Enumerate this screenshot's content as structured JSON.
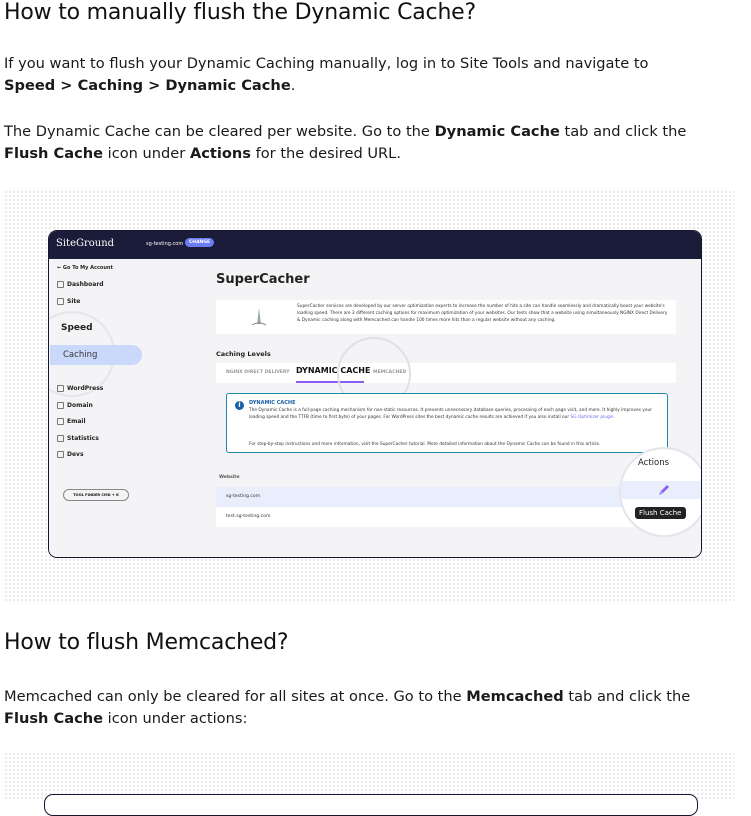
{
  "sections": [
    {
      "heading": "How to manually flush the Dynamic Cache?",
      "p1": {
        "text": "If you want to flush your Dynamic Caching manually, log in to Site Tools and navigate to ",
        "b1": "Speed > Caching > Dynamic Cache",
        "end": "."
      },
      "p2": {
        "t1": "The Dynamic Cache can be cleared per website. Go to the ",
        "b1": "Dynamic Cache",
        "t2": " tab and click the ",
        "b2": "Flush Cache",
        "t3": " icon under ",
        "b3": "Actions",
        "t4": " for the desired URL."
      }
    },
    {
      "heading": "How to flush Memcached?",
      "p1": {
        "t1": "Memcached can only be cleared for all sites at once. Go to the ",
        "b1": "Memcached",
        "t2": " tab and click the ",
        "b2": "Flush Cache",
        "t3": " icon under actions:"
      }
    }
  ],
  "screenshot": {
    "logo": "SiteGround",
    "domain": "sg-testing.com",
    "change": "CHANGE",
    "go_to_account": "← Go To My Account",
    "nav": [
      "Dashboard",
      "Site"
    ],
    "speed": "Speed",
    "caching": "Caching",
    "nav2": [
      "WordPress",
      "Domain",
      "Email",
      "Statistics",
      "Devs"
    ],
    "tool_finder": "TOOL FINDER CMD + K",
    "title": "SuperCacher",
    "intro": "SuperCacher services are developed by our server optimization experts to increase the number of hits a site can handle seamlessly and dramatically boost your website's loading speed. There are 3 different caching options for maximum optimization of your websites. Our tests show that a website using simultaneously NGINX Direct Delivery & Dynamic caching along with Memcached can handle 100 times more hits than a regular website without any caching.",
    "levels_label": "Caching Levels",
    "tabs": [
      "NGINX DIRECT DELIVERY",
      "DYNAMIC CACHE",
      "MEMCACHED"
    ],
    "info_title": "DYNAMIC CACHE",
    "info_text": "The Dynamic Cache is a full-page caching mechanism for non-static resources. It prevents unnecessary database queries, processing of each page visit, and more. It highly improves your loading speed and the TTFB (time to first byte) of your pages. For WordPress sites the best dynamic cache results are achieved if you also install our",
    "info_link": "SG Optimizer plugin.",
    "info_more": "For step-by-step instructions and more information, visit the SuperCacher tutorial. More detailed information about the Dynamic Cache can be found in this article.",
    "table_header": "Website",
    "rows": [
      "sg-testing.com",
      "test.sg-testing.com"
    ],
    "actions": "Actions",
    "flush_tooltip": "Flush Cache"
  }
}
